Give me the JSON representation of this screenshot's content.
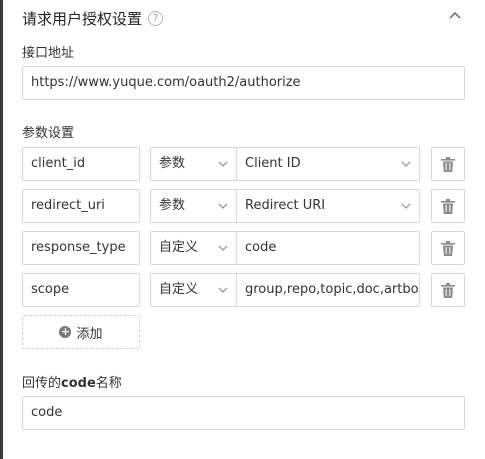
{
  "section": {
    "title": "请求用户授权设置",
    "help_icon": "question-circle-icon",
    "collapse_icon": "chevron-up-icon"
  },
  "endpoint": {
    "label": "接口地址",
    "value": "https://www.yuque.com/oauth2/authorize"
  },
  "params": {
    "label": "参数设置",
    "rows": [
      {
        "name": "client_id",
        "type": "参数",
        "value": "Client ID",
        "value_is_select": true
      },
      {
        "name": "redirect_uri",
        "type": "参数",
        "value": "Redirect URI",
        "value_is_select": true
      },
      {
        "name": "response_type",
        "type": "自定义",
        "value": "code",
        "value_is_select": false
      },
      {
        "name": "scope",
        "type": "自定义",
        "value": "group,repo,topic,doc,artboard",
        "value_is_select": false
      }
    ],
    "delete_icon": "trash-icon",
    "add_label": "添加",
    "add_icon": "plus-circle-icon"
  },
  "callback": {
    "label_prefix": "回传的",
    "label_bold": "code",
    "label_suffix": "名称",
    "value": "code"
  },
  "colors": {
    "border": "#d9d9d9",
    "text": "#333333",
    "icon": "#8c8c8c"
  }
}
